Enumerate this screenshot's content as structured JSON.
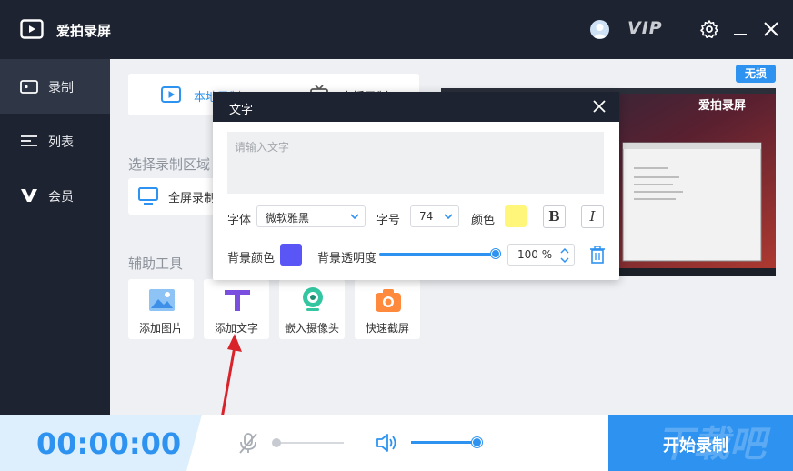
{
  "app": {
    "title": "爱拍录屏",
    "vip_label": "VIP"
  },
  "sidebar": {
    "items": [
      {
        "label": "录制",
        "icon": "record-camera-icon",
        "active": true
      },
      {
        "label": "列表",
        "icon": "list-icon",
        "active": false
      },
      {
        "label": "会员",
        "icon": "vip-v-icon",
        "active": false
      }
    ]
  },
  "main": {
    "mode_tabs": [
      {
        "label": "本地录制"
      },
      {
        "label": "直播录制"
      }
    ],
    "area_section_label": "选择录制区域",
    "area_option_label": "全屏录制",
    "tools_section_label": "辅助工具",
    "tools": [
      {
        "label": "添加图片",
        "icon": "image-icon"
      },
      {
        "label": "添加文字",
        "icon": "text-t-icon"
      },
      {
        "label": "嵌入摄像头",
        "icon": "webcam-icon"
      },
      {
        "label": "快速截屏",
        "icon": "camera-icon"
      }
    ],
    "lossless_badge": "无损",
    "preview_logo_text": "爱拍录屏"
  },
  "text_dialog": {
    "title": "文字",
    "placeholder": "请输入文字",
    "font_label": "字体",
    "font_value": "微软雅黑",
    "size_label": "字号",
    "size_value": "74",
    "color_label": "颜色",
    "text_color": "#fff67a",
    "bold_label": "B",
    "italic_label": "I",
    "bg_color_label": "背景颜色",
    "bg_color": "#5a55f5",
    "opacity_label": "背景透明度",
    "opacity_value": "100 %",
    "opacity_fraction": 1.0
  },
  "bottom": {
    "timer": "00:00:00",
    "start_label": "开始录制",
    "watermark": "下载吧"
  },
  "colors": {
    "accent": "#2e93f0",
    "titlebar": "#1d2330"
  }
}
